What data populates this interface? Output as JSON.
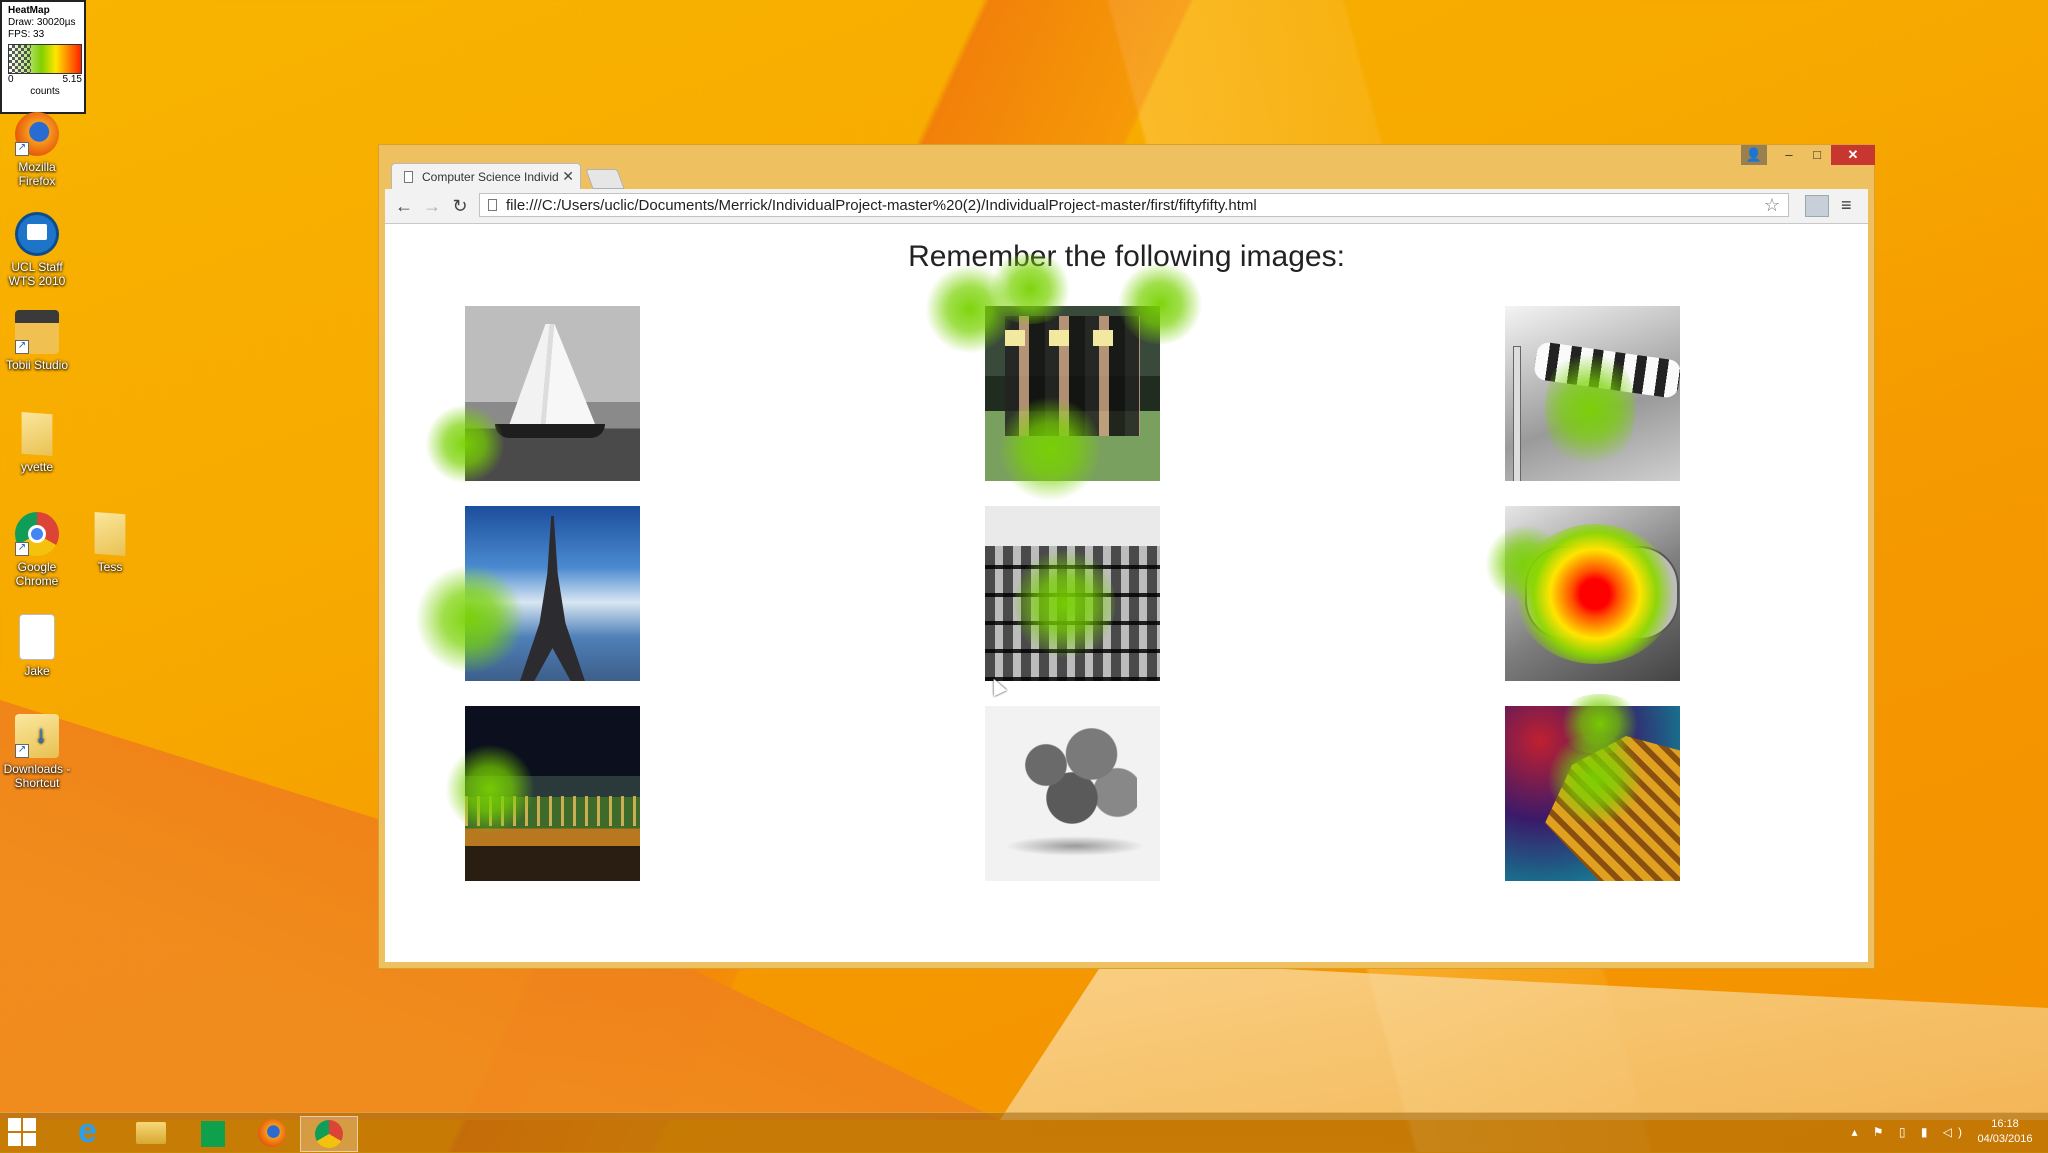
{
  "heatmap_widget": {
    "title": "HeatMap",
    "draw": "Draw: 30020µs",
    "fps": "FPS: 33",
    "scale_min": "0",
    "scale_max": "5.15",
    "unit": "counts"
  },
  "desktop_icons": [
    {
      "label": "Mozilla Firefox",
      "icon": "firefox-icon"
    },
    {
      "label": "UCL Staff WTS 2010",
      "icon": "remote-desktop-icon"
    },
    {
      "label": "Tobii Studio",
      "icon": "tobii-studio-icon"
    },
    {
      "label": "yvette",
      "icon": "folder-icon"
    },
    {
      "label": "Google Chrome",
      "icon": "chrome-icon"
    },
    {
      "label": "Tess",
      "icon": "folder-icon"
    },
    {
      "label": "Jake",
      "icon": "document-icon"
    },
    {
      "label": "Downloads - Shortcut",
      "icon": "downloads-folder-icon"
    }
  ],
  "browser": {
    "tab_title": "Computer Science Individu",
    "url": "file:///C:/Users/uclic/Documents/Merrick/IndividualProject-master%20(2)/IndividualProject-master/first/fiftyfifty.html",
    "window_controls": {
      "minimize": "–",
      "maximize": "□",
      "close": "✕"
    }
  },
  "page": {
    "heading": "Remember the following images:",
    "images": [
      {
        "subject": "sailing ship",
        "style": "grayscale"
      },
      {
        "subject": "marathon runners",
        "style": "color"
      },
      {
        "subject": "striped windsock",
        "style": "grayscale"
      },
      {
        "subject": "Eiffel Tower",
        "style": "color"
      },
      {
        "subject": "building facade",
        "style": "grayscale"
      },
      {
        "subject": "machine part",
        "style": "grayscale"
      },
      {
        "subject": "bridge at night",
        "style": "color"
      },
      {
        "subject": "oranges",
        "style": "grayscale"
      },
      {
        "subject": "golden dragon",
        "style": "color"
      }
    ]
  },
  "heatmap_colors": {
    "low": "#78d200",
    "mid": "#ffe400",
    "high": "#ff0000"
  },
  "taskbar": {
    "apps": [
      "start-icon",
      "internet-explorer-icon",
      "file-explorer-icon",
      "store-icon",
      "firefox-icon",
      "chrome-icon"
    ],
    "time": "16:18",
    "date": "04/03/2016"
  }
}
